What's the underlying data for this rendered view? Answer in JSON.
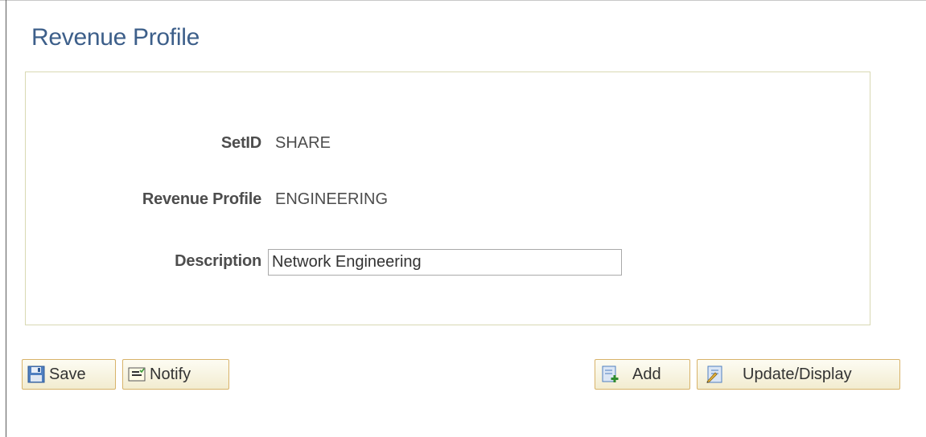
{
  "page": {
    "title": "Revenue Profile"
  },
  "form": {
    "setid": {
      "label": "SetID",
      "value": "SHARE"
    },
    "revenue_profile": {
      "label": "Revenue Profile",
      "value": "ENGINEERING"
    },
    "description": {
      "label": "Description",
      "value": "Network Engineering"
    }
  },
  "toolbar": {
    "save_label": "Save",
    "save_icon": "save-icon",
    "notify_label": "Notify",
    "notify_icon": "notify-icon",
    "add_label": "Add",
    "add_icon": "add-icon",
    "update_label": "Update/Display",
    "update_icon": "update-display-icon"
  },
  "colors": {
    "title": "#3d5f8a",
    "panel_border": "#d9d9b3",
    "button_border": "#d8b36a"
  }
}
